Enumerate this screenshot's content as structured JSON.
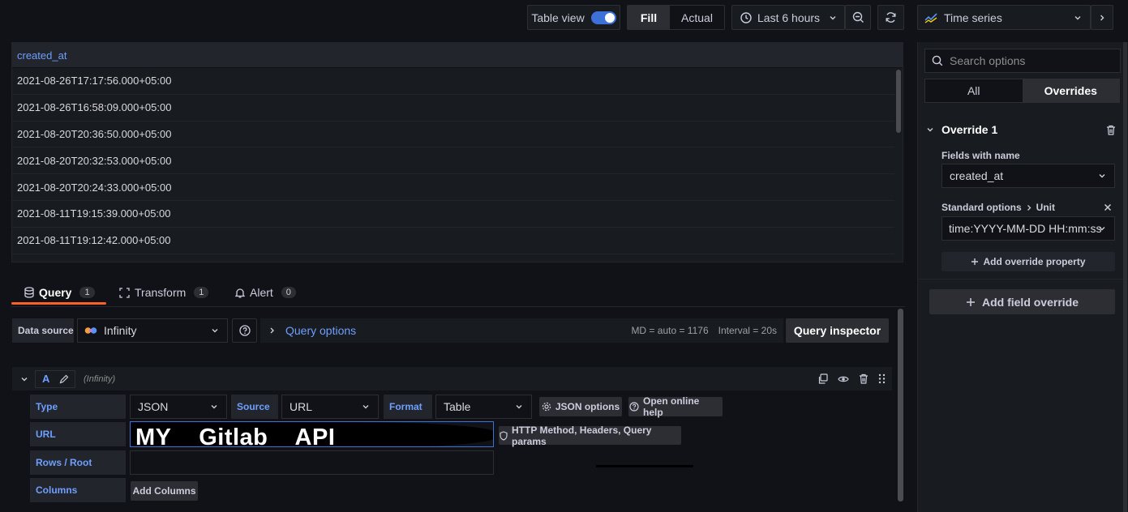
{
  "toolbar": {
    "table_view_label": "Table view",
    "fill_label": "Fill",
    "actual_label": "Actual",
    "time_range": "Last 6 hours",
    "viz_type": "Time series"
  },
  "table": {
    "header": "created_at",
    "rows": [
      "2021-08-26T17:17:56.000+05:00",
      "2021-08-26T16:58:09.000+05:00",
      "2021-08-20T20:36:50.000+05:00",
      "2021-08-20T20:32:53.000+05:00",
      "2021-08-20T20:24:33.000+05:00",
      "2021-08-11T19:15:39.000+05:00",
      "2021-08-11T19:12:42.000+05:00"
    ]
  },
  "tabs": [
    {
      "label": "Query",
      "count": "1"
    },
    {
      "label": "Transform",
      "count": "1"
    },
    {
      "label": "Alert",
      "count": "0"
    }
  ],
  "query_row": {
    "data_source_label": "Data source",
    "data_source_value": "Infinity",
    "query_options_label": "Query options",
    "md_info": "MD = auto = 1176",
    "interval_info": "Interval = 20s",
    "inspector_label": "Query inspector"
  },
  "query_a": {
    "ref_id": "A",
    "datasource_name": "(Infinity)",
    "type_label": "Type",
    "type_value": "JSON",
    "source_label": "Source",
    "source_value": "URL",
    "format_label": "Format",
    "format_value": "Table",
    "json_options_label": "JSON options",
    "online_help_label": "Open online help",
    "url_label": "URL",
    "url_value": "MY    Gitlab    API",
    "http_method_label": "HTTP Method, Headers, Query params",
    "rows_root_label": "Rows / Root",
    "columns_label": "Columns",
    "add_columns_label": "Add Columns"
  },
  "options_pane": {
    "search_placeholder": "Search options",
    "tab_all": "All",
    "tab_overrides": "Overrides",
    "override_title": "Override 1",
    "fields_with_name_label": "Fields with name",
    "fields_with_name_value": "created_at",
    "standard_options_label": "Standard options",
    "unit_label": "Unit",
    "unit_value": "time:YYYY-MM-DD HH:mm:ss",
    "add_override_property_label": "Add override property",
    "add_field_override_label": "Add field override"
  },
  "colors": {
    "background": "#111217",
    "panel": "#181b1f",
    "accent_blue": "#6e9fff",
    "tab_underline": "#ff5f22",
    "toggle_on": "#3d71d9"
  }
}
